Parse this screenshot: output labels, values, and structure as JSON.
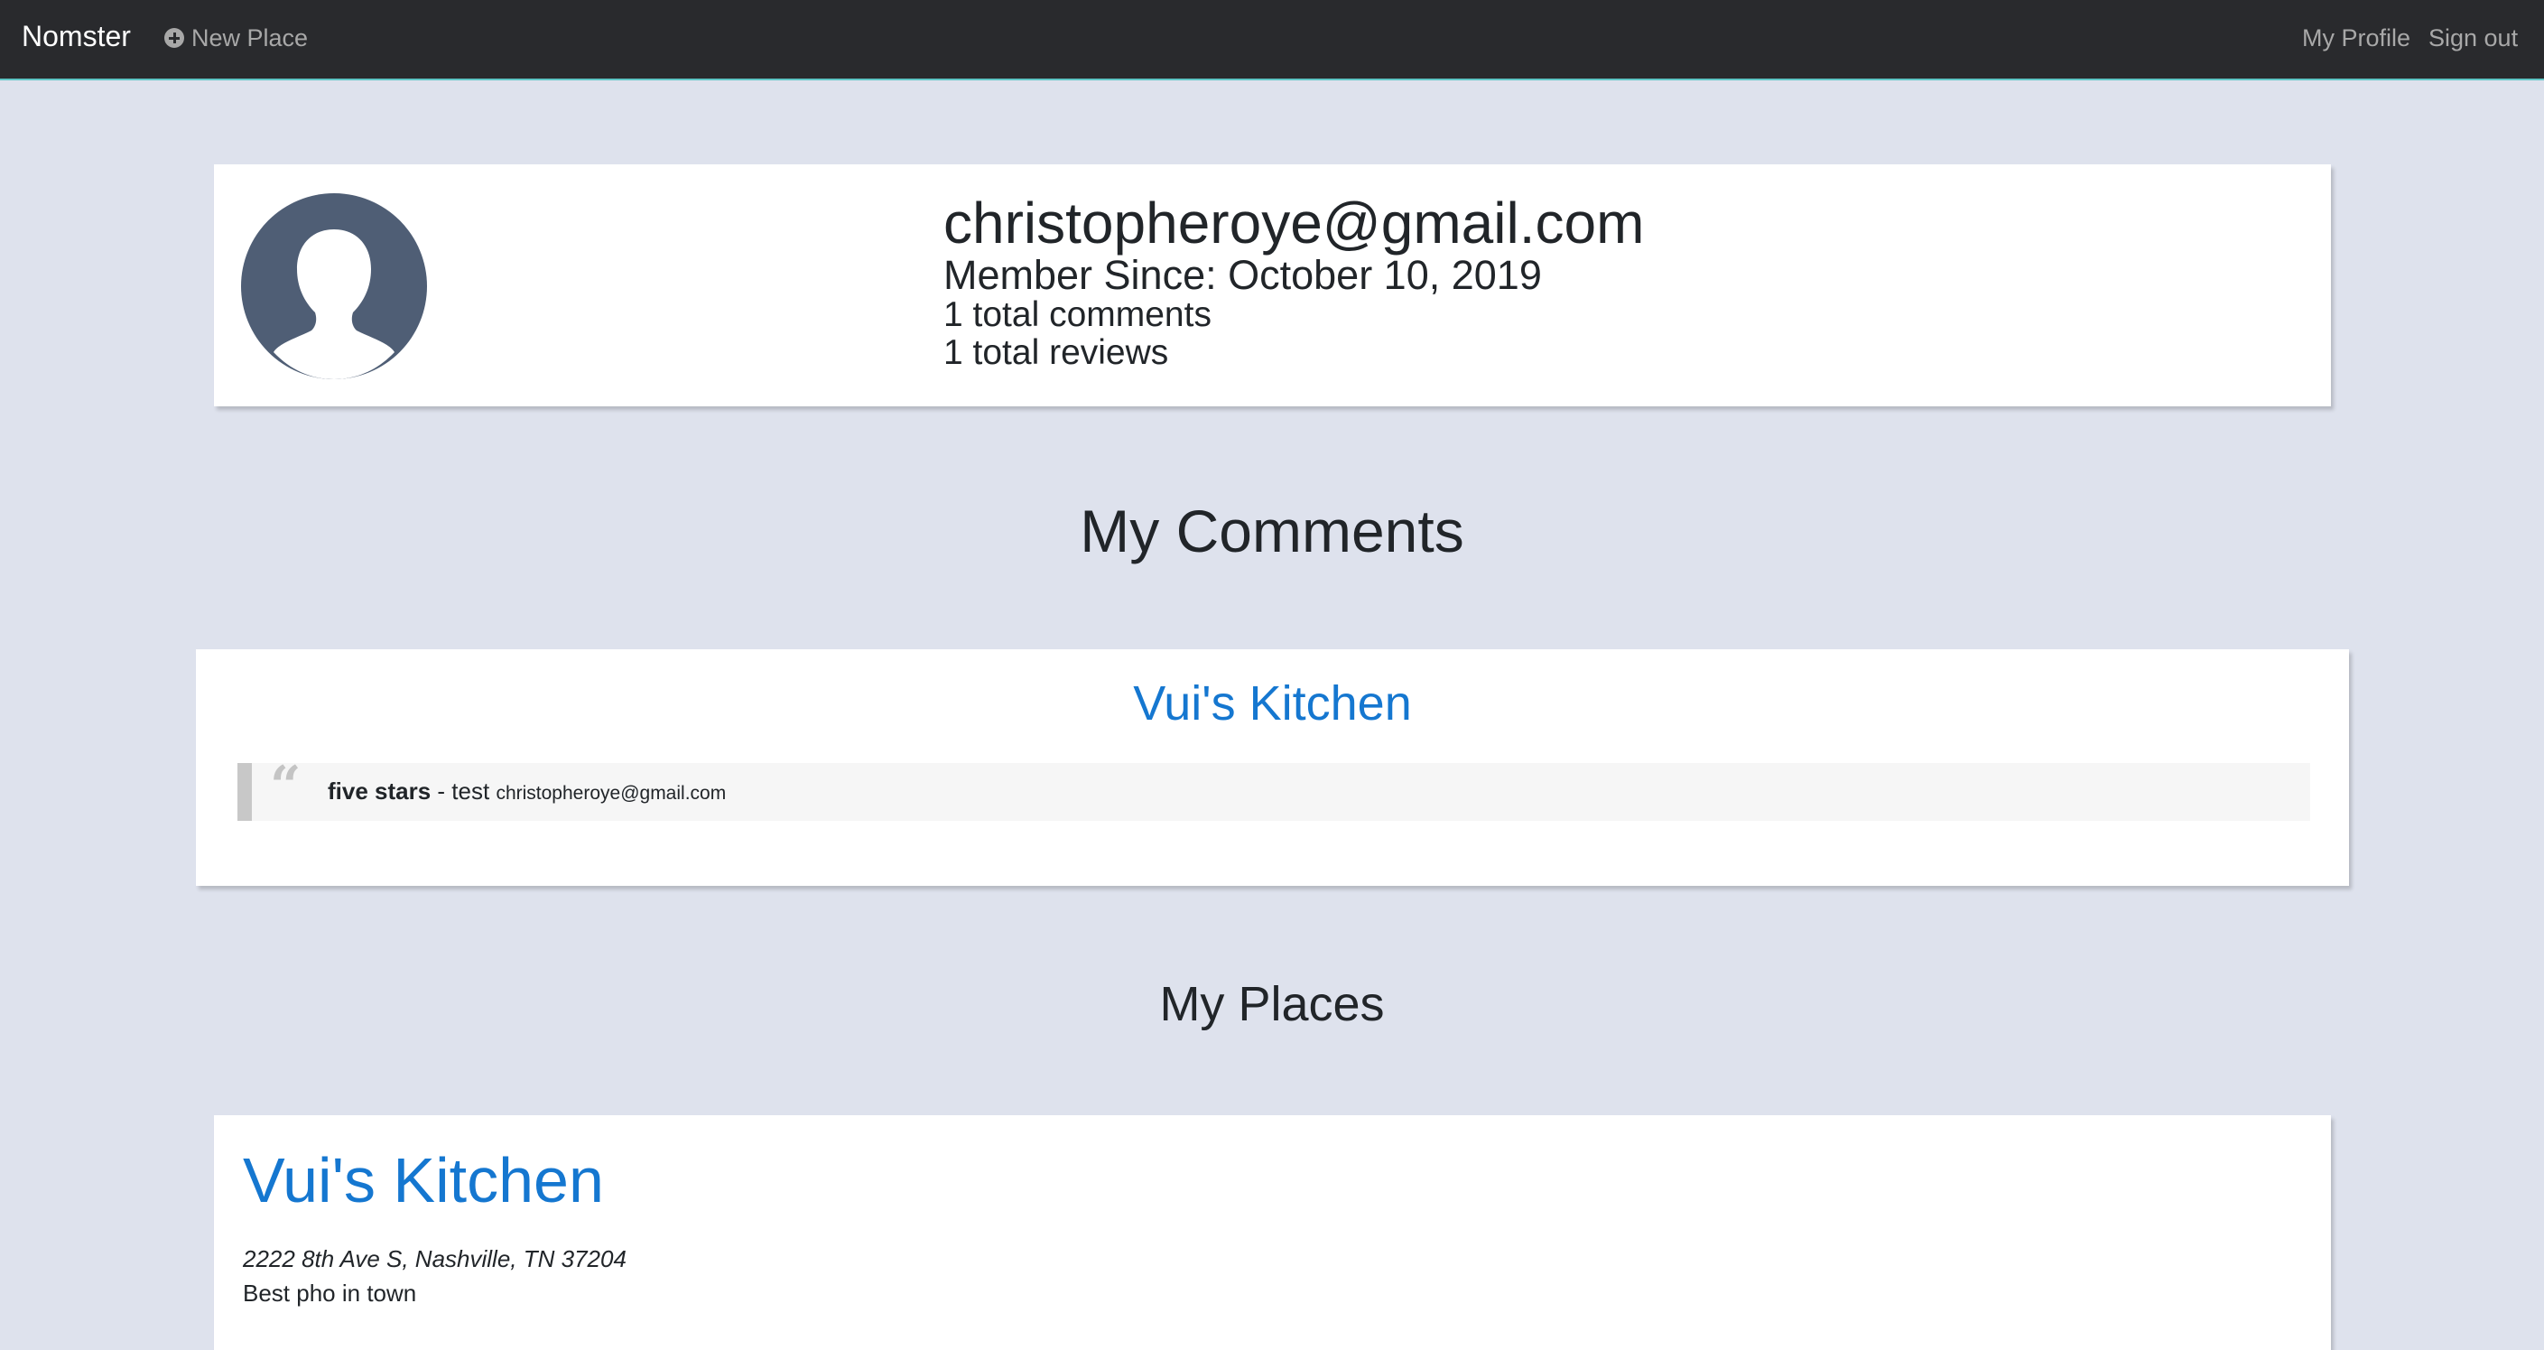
{
  "nav": {
    "brand": "Nomster",
    "new_place": "New Place",
    "my_profile": "My Profile",
    "sign_out": "Sign out",
    "new_place_icon": "plus-circle-icon"
  },
  "profile": {
    "avatar_icon": "user-silhouette-icon",
    "email": "christopheroye@gmail.com",
    "member_since": "Member Since: October 10, 2019",
    "total_comments": "1 total comments",
    "total_reviews": "1 total reviews"
  },
  "comments_section": {
    "title": "My Comments",
    "items": [
      {
        "place": "Vui's Kitchen",
        "rating": "five stars",
        "separator": " - ",
        "message": "test",
        "author": "christopheroye@gmail.com",
        "quote_icon": "quote-icon"
      }
    ]
  },
  "places_section": {
    "title": "My Places",
    "items": [
      {
        "name": "Vui's Kitchen",
        "address": "2222 8th Ave S, Nashville, TN 37204",
        "description": "Best pho in town"
      }
    ]
  },
  "colors": {
    "navbar_bg": "#292a2d",
    "page_bg": "#dee2ed",
    "link": "#1577d0",
    "avatar_bg": "#4f5e75"
  }
}
